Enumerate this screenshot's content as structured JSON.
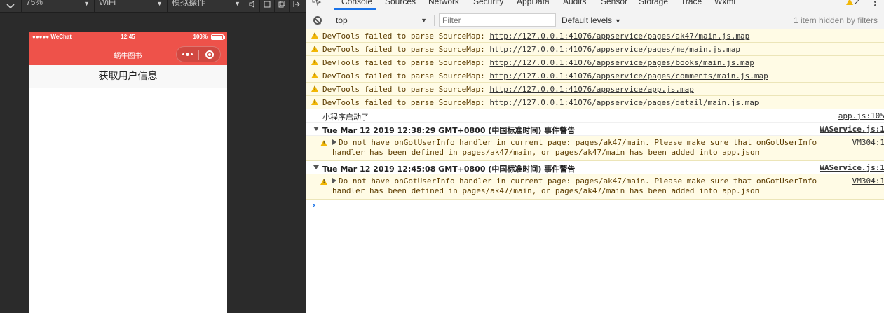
{
  "simulator": {
    "toolbar": {
      "zoom": "75%",
      "network": "WiFi",
      "mode": "模拟操作"
    },
    "status_bar": {
      "carrier": "●●●●● WeChat",
      "time": "12:45",
      "battery": "100%"
    },
    "nav": {
      "title": "蜗牛图书"
    },
    "button_label": "获取用户信息"
  },
  "devtools": {
    "tabs": [
      "Console",
      "Sources",
      "Network",
      "Security",
      "AppData",
      "Audits",
      "Sensor",
      "Storage",
      "Trace",
      "Wxml"
    ],
    "active_tab": "Console",
    "warning_count": "2",
    "context": "top",
    "filter_placeholder": "Filter",
    "levels": "Default levels",
    "hidden_info": "1 item hidden by filters",
    "sourcemap_prefix": "DevTools failed to parse SourceMap:",
    "sourcemap_urls": [
      "http://127.0.0.1:41076/appservice/pages/ak47/main.js.map",
      "http://127.0.0.1:41076/appservice/pages/me/main.js.map",
      "http://127.0.0.1:41076/appservice/pages/books/main.js.map",
      "http://127.0.0.1:41076/appservice/pages/comments/main.js.map",
      "http://127.0.0.1:41076/appservice/app.js.map",
      "http://127.0.0.1:41076/appservice/pages/detail/main.js.map"
    ],
    "log_message": "小程序启动了",
    "log_source": "app.js:105",
    "groups": [
      {
        "title": "Tue Mar 12 2019 12:38:29 GMT+0800 (中国标准时间) 事件警告",
        "source": "WAService.js:1",
        "line1": "Do not have onGotUserInfo handler in current page: pages/ak47/main. Please make sure that onGotUserInfo",
        "line2": "handler has been defined in pages/ak47/main, or pages/ak47/main has been added into app.json",
        "vm": "VM304:1"
      },
      {
        "title": "Tue Mar 12 2019 12:45:08 GMT+0800 (中国标准时间) 事件警告",
        "source": "WAService.js:1",
        "line1": "Do not have onGotUserInfo handler in current page: pages/ak47/main. Please make sure that onGotUserInfo",
        "line2": "handler has been defined in pages/ak47/main, or pages/ak47/main has been added into app.json",
        "vm": "VM304:1"
      }
    ],
    "prompt": "›"
  },
  "colors": {
    "brand_red": "#ee524a",
    "warning_bg": "#fffbe5",
    "accent_blue": "#1a73e8"
  }
}
